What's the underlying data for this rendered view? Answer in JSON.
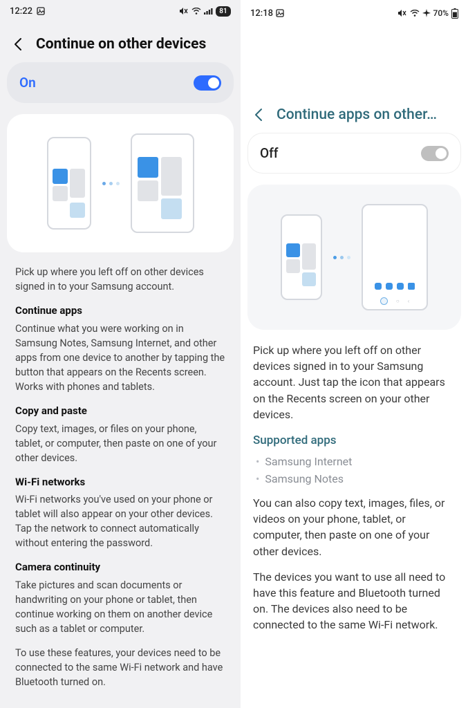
{
  "left": {
    "status": {
      "time": "12:22",
      "battery": "81"
    },
    "header": {
      "title": "Continue on other devices"
    },
    "toggle": {
      "label": "On",
      "on": true
    },
    "intro": "Pick up where you left off on other devices signed in to your Samsung account.",
    "sections": [
      {
        "title": "Continue apps",
        "body": "Continue what you were working on in Samsung Notes, Samsung Internet, and other apps from one device to another by tapping the button that appears on the Recents screen. Works with phones and tablets."
      },
      {
        "title": "Copy and paste",
        "body": "Copy text, images, or files on your phone, tablet, or computer, then paste on one of your other devices."
      },
      {
        "title": "Wi-Fi networks",
        "body": "Wi-Fi networks you've used on your phone or tablet will also appear on your other devices. Tap the network to connect automatically without entering the password."
      },
      {
        "title": "Camera continuity",
        "body": "Take pictures and scan documents or handwriting on your phone or tablet, then continue working on them on another device such as a tablet or computer."
      }
    ],
    "footer": "To use these features, your devices need to be connected to the same Wi-Fi network and have Bluetooth turned on."
  },
  "right": {
    "status": {
      "time": "12:18",
      "battery": "70%"
    },
    "header": {
      "title": "Continue apps on other…"
    },
    "toggle": {
      "label": "Off",
      "on": false
    },
    "intro": "Pick up where you left off on other devices signed in to your Samsung account. Just tap the icon that appears on the Recents screen on your other devices.",
    "supported": {
      "title": "Supported apps",
      "items": [
        "Samsung Internet",
        "Samsung Notes"
      ]
    },
    "copy_para": "You can also copy text, images, files, or videos on your phone, tablet, or computer, then paste on one of your other devices.",
    "req_para": "The devices you want to use all need to have this feature and Bluetooth turned on. The devices also need to be connected to the same Wi-Fi network."
  }
}
